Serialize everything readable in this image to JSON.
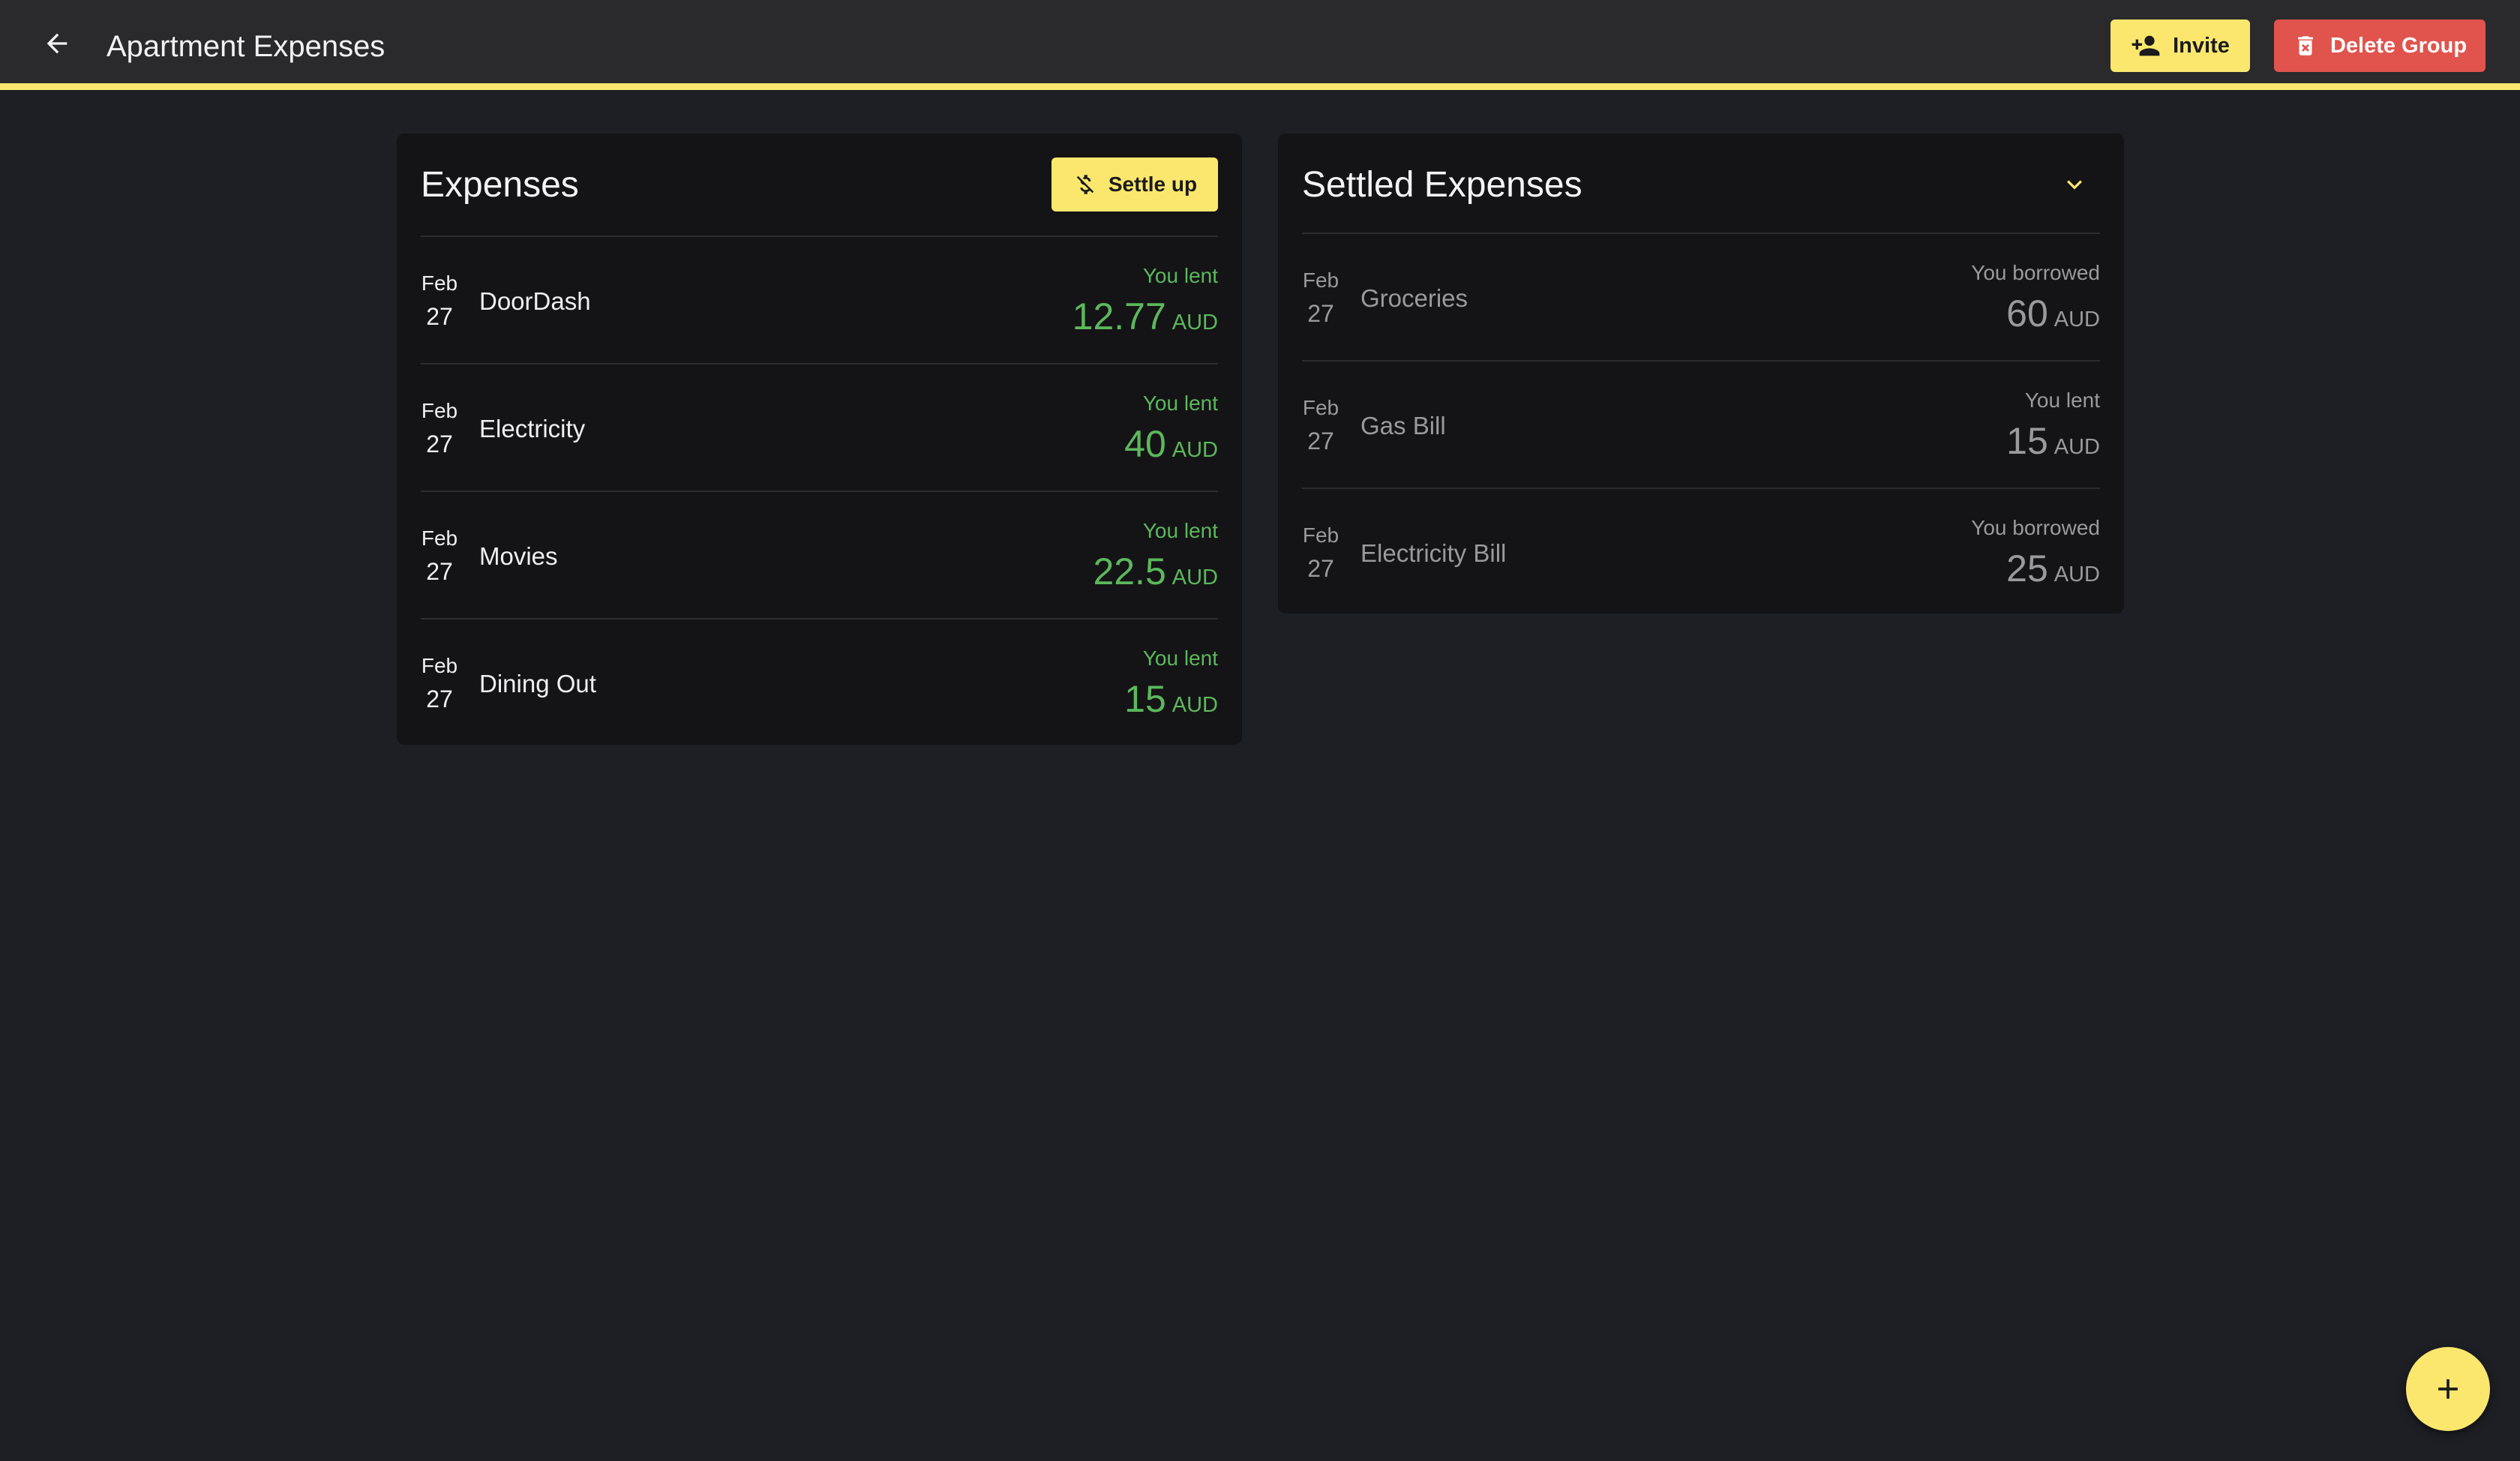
{
  "header": {
    "title": "Apartment Expenses",
    "invite_label": "Invite",
    "delete_label": "Delete Group"
  },
  "colors": {
    "accent": "#fbe76e",
    "danger": "#e0544d",
    "positive": "#5cb85c",
    "muted": "#9a9a9a",
    "background": "#1e1f24",
    "card": "#141416"
  },
  "expenses": {
    "title": "Expenses",
    "settle_label": "Settle up",
    "items": [
      {
        "month": "Feb",
        "day": "27",
        "name": "DoorDash",
        "label": "You lent",
        "amount": "12.77",
        "currency": "AUD"
      },
      {
        "month": "Feb",
        "day": "27",
        "name": "Electricity",
        "label": "You lent",
        "amount": "40",
        "currency": "AUD"
      },
      {
        "month": "Feb",
        "day": "27",
        "name": "Movies",
        "label": "You lent",
        "amount": "22.5",
        "currency": "AUD"
      },
      {
        "month": "Feb",
        "day": "27",
        "name": "Dining Out",
        "label": "You lent",
        "amount": "15",
        "currency": "AUD"
      }
    ]
  },
  "settled": {
    "title": "Settled Expenses",
    "items": [
      {
        "month": "Feb",
        "day": "27",
        "name": "Groceries",
        "label": "You borrowed",
        "amount": "60",
        "currency": "AUD"
      },
      {
        "month": "Feb",
        "day": "27",
        "name": "Gas Bill",
        "label": "You lent",
        "amount": "15",
        "currency": "AUD"
      },
      {
        "month": "Feb",
        "day": "27",
        "name": "Electricity Bill",
        "label": "You borrowed",
        "amount": "25",
        "currency": "AUD"
      }
    ]
  },
  "icons": {
    "back": "arrow-left-icon",
    "invite": "person-add-icon",
    "delete": "trash-icon",
    "settle": "money-off-icon",
    "collapse": "chevron-down-icon",
    "add": "plus-icon"
  }
}
